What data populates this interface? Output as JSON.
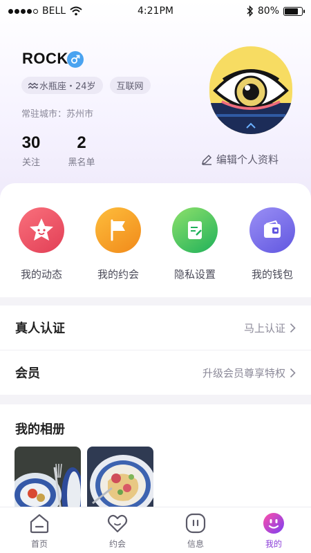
{
  "status_bar": {
    "carrier": "BELL",
    "time": "4:21PM",
    "battery": "80%",
    "battery_level": 0.8
  },
  "profile": {
    "name": "ROCK",
    "tags": [
      {
        "icon": "aquarius-icon",
        "label": "水瓶座・24岁"
      },
      {
        "label": "互联网"
      }
    ],
    "city": "常驻城市：苏州市",
    "stats": [
      {
        "value": "30",
        "label": "关注"
      },
      {
        "value": "2",
        "label": "黑名单"
      }
    ],
    "edit_label": "编辑个人资料"
  },
  "quick_actions": [
    {
      "label": "我的动态",
      "icon": "star-face-icon",
      "color": "#ee5a6a"
    },
    {
      "label": "我的约会",
      "icon": "flag-icon",
      "color": "#f7a428"
    },
    {
      "label": "隐私设置",
      "icon": "document-edit-icon",
      "color": "#4cc46a"
    },
    {
      "label": "我的钱包",
      "icon": "wallet-icon",
      "color": "#7a72ee"
    }
  ],
  "rows": [
    {
      "title": "真人认证",
      "action": "马上认证"
    },
    {
      "title": "会员",
      "action": "升级会员尊享特权"
    }
  ],
  "album": {
    "title": "我的相册"
  },
  "tabs": [
    {
      "label": "首页",
      "icon": "home-icon"
    },
    {
      "label": "约会",
      "icon": "heart-icon"
    },
    {
      "label": "信息",
      "icon": "message-icon"
    },
    {
      "label": "我的",
      "icon": "profile-face-icon",
      "active": true
    }
  ],
  "colors": {
    "accent": "#8b3dd8",
    "gender": "#4aa3f0"
  }
}
